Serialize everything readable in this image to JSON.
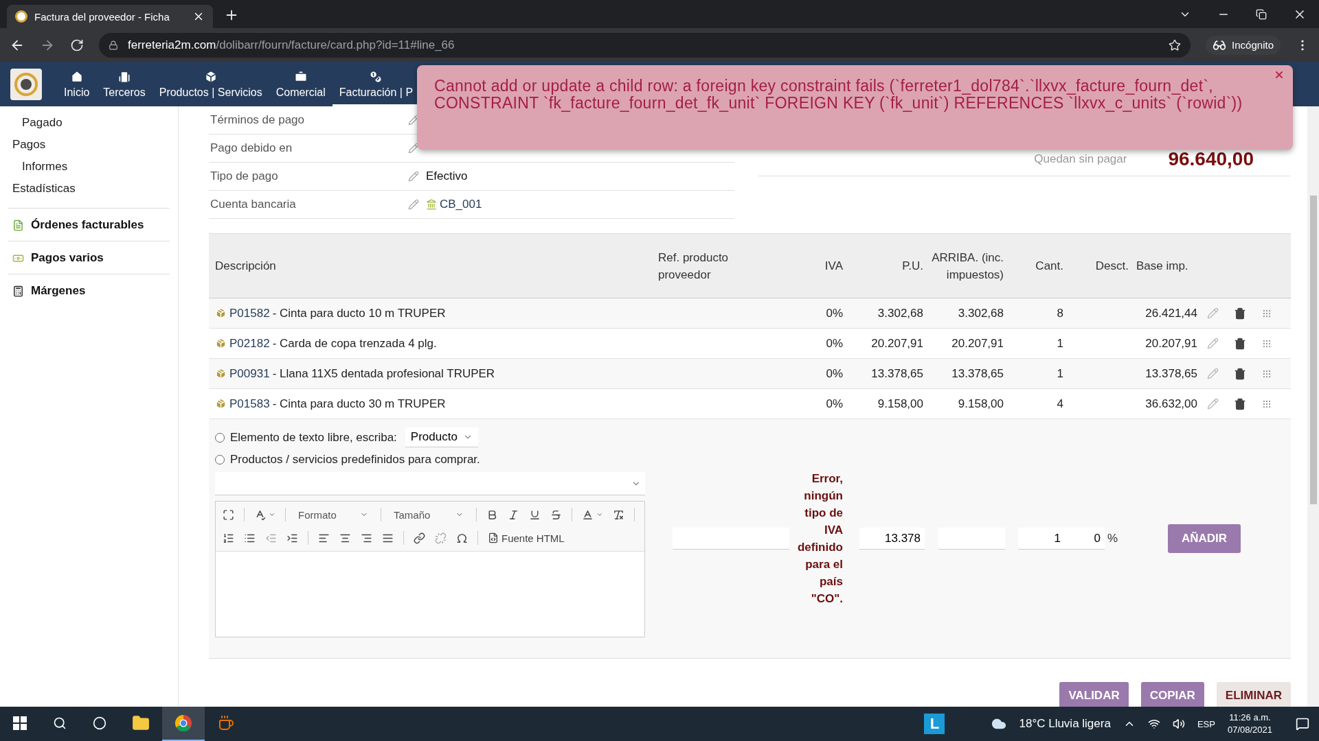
{
  "browser": {
    "tab_title": "Factura del proveedor - Ficha",
    "url_host": "ferreteria2m.com",
    "url_path": "/dolibarr/fourn/facture/card.php?id=11#line_66",
    "profile_label": "Incógnito"
  },
  "nav": {
    "items": [
      {
        "label": "Inicio",
        "kind": "home",
        "selected": false
      },
      {
        "label": "Terceros",
        "kind": "building",
        "selected": false
      },
      {
        "label": "Productos | Servicios",
        "kind": "box",
        "selected": false
      },
      {
        "label": "Comercial",
        "kind": "briefcase",
        "selected": false
      },
      {
        "label": "Facturación | P",
        "kind": "coins",
        "selected": true
      }
    ]
  },
  "alert": {
    "message": "Cannot add or update a child row: a foreign key constraint fails (`ferreter1_dol784`.`llxvx_facture_fourn_det`, CONSTRAINT `fk_facture_fourn_det_fk_unit` FOREIGN KEY (`fk_unit`) REFERENCES `llxvx_c_units` (`rowid`))"
  },
  "sidebar": {
    "items": [
      {
        "label": "Pagado",
        "kind": "sub"
      },
      {
        "label": "Pagos",
        "kind": "entry"
      },
      {
        "label": "Informes",
        "kind": "sub"
      },
      {
        "label": "Estadísticas",
        "kind": "entry"
      },
      {
        "label": "Órdenes facturables",
        "kind": "orders"
      },
      {
        "label": "Pagos varios",
        "kind": "payments"
      },
      {
        "label": "Márgenes",
        "kind": "margins"
      }
    ]
  },
  "fields": [
    {
      "label": "Términos de pago",
      "kind": "text"
    },
    {
      "label": "Pago debido en",
      "kind": "text"
    },
    {
      "label": "Tipo de pago",
      "value": "Efectivo",
      "kind": "text"
    },
    {
      "label": "Cuenta bancaria",
      "value": "CB_001",
      "kind": "bank"
    }
  ],
  "summary": {
    "label": "Quedan sin pagar",
    "value": "96.640,00"
  },
  "table": {
    "columns": [
      "Descripción",
      "Ref. producto proveedor",
      "IVA",
      "P.U.",
      "ARRIBA. (inc. impuestos)",
      "Cant.",
      "Desct.",
      "Base imp."
    ],
    "rows": [
      {
        "ref": "P01582",
        "description": "- Cinta para ducto 10 m TRUPER",
        "iva": "0%",
        "unit_price": "3.302,68",
        "unit_price_tax": "3.302,68",
        "qty": "8",
        "total": "26.421,44"
      },
      {
        "ref": "P02182",
        "description": "- Carda de copa trenzada 4 plg.",
        "iva": "0%",
        "unit_price": "20.207,91",
        "unit_price_tax": "20.207,91",
        "qty": "1",
        "total": "20.207,91"
      },
      {
        "ref": "P00931",
        "description": "- Llana 11X5 dentada profesional TRUPER",
        "iva": "0%",
        "unit_price": "13.378,65",
        "unit_price_tax": "13.378,65",
        "qty": "1",
        "total": "13.378,65"
      },
      {
        "ref": "P01583",
        "description": "- Cinta para ducto 30 m TRUPER",
        "iva": "0%",
        "unit_price": "9.158,00",
        "unit_price_tax": "9.158,00",
        "qty": "4",
        "total": "36.632,00"
      }
    ]
  },
  "add_form": {
    "options": [
      {
        "label": "Elemento de texto libre, escriba:",
        "selected": false
      },
      {
        "label": "Productos / servicios predefinidos para comprar.",
        "selected": false
      }
    ],
    "type_select": "Producto",
    "editor": {
      "format_label": "Formato",
      "size_label": "Tamaño",
      "source_label": "Fuente HTML"
    },
    "error": "Error, ningún tipo de IVA definido para el país \"CO\".",
    "unit_price": "13.378",
    "qty": "1",
    "discount": "0",
    "percent_sign": "%",
    "add_button": "AÑADIR"
  },
  "actions": [
    {
      "label": "VALIDAR",
      "kind": "primary"
    },
    {
      "label": "COPIAR",
      "kind": "primary"
    },
    {
      "label": "ELIMINAR",
      "kind": "danger"
    }
  ],
  "taskbar": {
    "apps": [
      {
        "kind": "explorer",
        "selected": false
      },
      {
        "kind": "chrome",
        "selected": true
      },
      {
        "kind": "java",
        "selected": false
      }
    ],
    "tray_app_label": "L",
    "weather": "18°C Lluvia ligera",
    "language": "ESP",
    "time": "11:26 a.m.",
    "date": "07/08/2021"
  }
}
